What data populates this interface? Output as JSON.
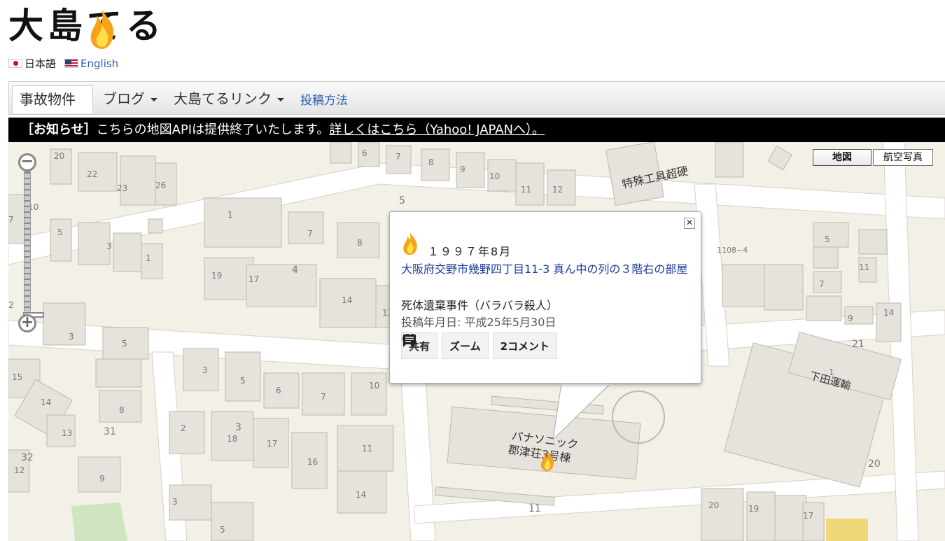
{
  "site": {
    "logo_text": "大島てる"
  },
  "languages": [
    {
      "label": "日本語"
    },
    {
      "label": "English"
    }
  ],
  "nav": {
    "items": [
      {
        "label": "事故物件"
      },
      {
        "label": "ブログ"
      },
      {
        "label": "大島てるリンク"
      }
    ],
    "link": "投稿方法"
  },
  "notice": {
    "tag": "［お知らせ］",
    "text": "こちらの地図APIは提供終了いたします。",
    "link": "詳しくはこちら（Yahoo! JAPANへ）。"
  },
  "map": {
    "types": [
      {
        "label": "地図",
        "active": true
      },
      {
        "label": "航空写真",
        "active": false
      }
    ],
    "zoom": {
      "out_symbol": "−",
      "in_symbol": "+"
    },
    "labels": {
      "l20a": "20",
      "l22": "22",
      "l23": "23",
      "l26": "26",
      "l10": "10",
      "l7": "7",
      "l5a": "5",
      "l3a": "3",
      "l1a": "1",
      "l6": "6",
      "l7b": "7",
      "l8": "8",
      "l9": "9",
      "l10b": "10",
      "l11": "11",
      "l12": "12",
      "l5b": "5",
      "l1b": "1",
      "l7c": "7",
      "l8b": "8",
      "l4": "4",
      "l19": "19",
      "l17": "17",
      "l14": "14",
      "l12b": "12",
      "l2": "2",
      "l3b": "3",
      "l5c": "5",
      "l15": "15",
      "l14b": "14",
      "l8c": "8",
      "l13": "13",
      "l31": "31",
      "l32": "32",
      "l12c": "12",
      "l9b": "9",
      "l3c": "3",
      "l5d": "5",
      "l6b": "6",
      "l7d": "7",
      "l10c": "10",
      "l2b": "2",
      "l3d": "3",
      "l18": "18",
      "l17b": "17",
      "l16": "16",
      "l11b": "11",
      "l14c": "14",
      "l11c": "11",
      "l3e": "3",
      "l5e": "5",
      "tokushu": "特殊工具超硬",
      "l1108": "1108−4",
      "l5f": "5",
      "l7e": "7",
      "l11d": "11",
      "l9c": "9",
      "l14d": "14",
      "l21": "21",
      "l1c": "1",
      "shimoda": "下田運輸",
      "l20b": "20",
      "l20c": "20",
      "l19b": "19",
      "l17c": "17",
      "panasonic1": "パナソニック",
      "panasonic2": "郡津荘3号棟"
    }
  },
  "popup": {
    "date": "１９９７年8月",
    "address": "大阪府交野市幾野四丁目11-3 真ん中の列の３階右の部屋",
    "incident": "死体遺棄事件（バラバラ殺人）",
    "posted": "投稿年月日: 平成25年5月30日",
    "buttons": {
      "share": "共有",
      "zoom": "ズーム",
      "comments": "2コメント"
    }
  },
  "colors": {
    "map_bg": "#f3f0e7",
    "building": "#e6e3dc",
    "link": "#2a5db0",
    "address": "#1a3c9c",
    "park": "#cfe5bf",
    "highlight": "#f0d77a"
  },
  "icons": {
    "marker": "flame-icon",
    "close": "close-icon",
    "share": "share-icon",
    "zoom": "magnify-icon",
    "comment": "comment-icon"
  }
}
